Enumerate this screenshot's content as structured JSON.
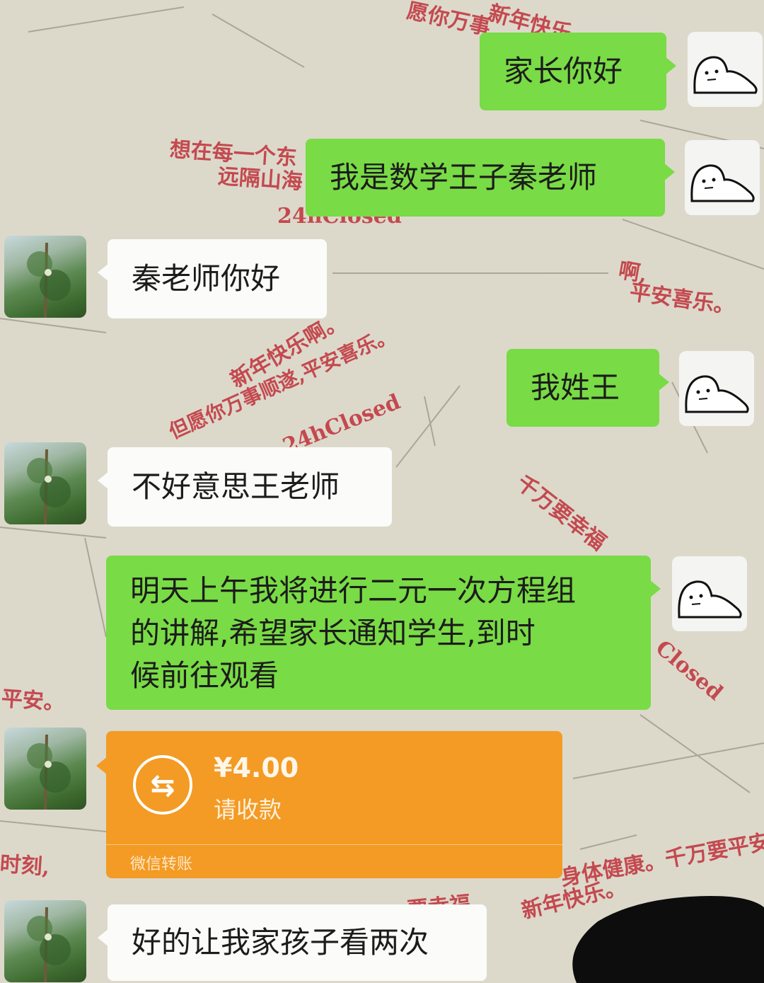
{
  "watermark_fragments": [
    "愿你万事",
    "新年快乐",
    "想在每一个东",
    "远隔山海",
    "24hClosed",
    "啊,",
    "平安喜乐。",
    "新年快乐啊。",
    "但愿你万事顺遂,平安喜乐。",
    "24hClosed",
    "千万要幸福",
    "平安。",
    "时刻,",
    "要幸福。",
    "身体健康。千万要平安",
    "新年快乐。",
    "Closed"
  ],
  "messages": [
    {
      "side": "right",
      "text": "家长你好"
    },
    {
      "side": "right",
      "text": "我是数学王子秦老师"
    },
    {
      "side": "left",
      "text": "秦老师你好"
    },
    {
      "side": "right",
      "text": "我姓王"
    },
    {
      "side": "left",
      "text": "不好意思王老师"
    },
    {
      "side": "right",
      "lines": [
        "明天上午我将进行二元一次方程组",
        "的讲解,希望家长通知学生,到时",
        "候前往观看"
      ]
    },
    {
      "side": "left",
      "text": "好的让我家孩子看两次"
    }
  ],
  "transfer": {
    "amount": "¥4.00",
    "description": "请收款",
    "footer": "微信转账",
    "icon": "transfer-arrows-icon"
  },
  "avatars": {
    "me": "cartoon-blob-avatar",
    "other": "tree-photo-avatar"
  },
  "colors": {
    "sent_bubble": "#79db45",
    "received_bubble": "#fbfbfa",
    "transfer": "#f39b24",
    "watermark": "#c0303a"
  }
}
